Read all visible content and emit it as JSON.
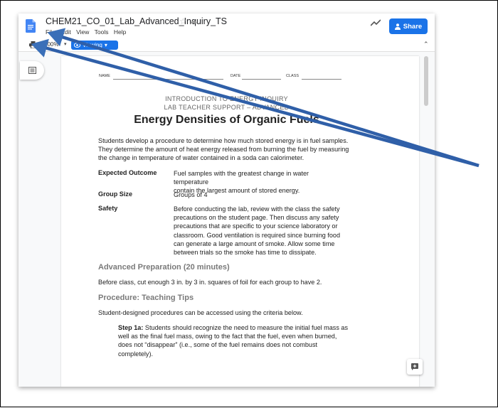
{
  "app": {
    "doc_title": "CHEM21_CO_01_Lab_Advanced_Inquiry_TS",
    "menu": [
      "File",
      "Edit",
      "View",
      "Tools",
      "Help"
    ],
    "share_label": "Share",
    "zoom": "100%",
    "view_label": "Viewing"
  },
  "doc": {
    "name_label": "NAME",
    "date_label": "DATE",
    "class_label": "CLASS",
    "header1": "INTRODUCTION TO ENERGY INQUIRY",
    "header2": "LAB TEACHER SUPPORT – ADVANCED",
    "title": "Energy Densities of Organic Fuels",
    "intro": [
      "Students develop a procedure to determine how much stored energy is in fuel samples.",
      "They determine the amount of heat energy released from burning the fuel by measuring",
      "the change in temperature of water contained in a soda can calorimeter."
    ],
    "outcome_label": "Expected Outcome",
    "outcome_lines": [
      "Fuel samples with the greatest change in water temperature",
      "contain the largest amount of stored energy."
    ],
    "group_label": "Group Size",
    "group_value": "Groups of 4",
    "safety_label": "Safety",
    "safety_lines": [
      "Before conducting the lab, review with the class the safety",
      "precautions on the student page. Then discuss any safety",
      "precautions that are specific to your science laboratory or",
      "classroom. Good ventilation is required since burning food",
      "can generate a large amount of smoke. Allow some time",
      "between trials so the smoke has time to dissipate."
    ],
    "prep_heading": "Advanced Preparation (20 minutes)",
    "prep_text": "Before class, cut enough 3 in. by 3 in. squares of foil for each group to have 2.",
    "proc_heading": "Procedure: Teaching Tips",
    "proc_text": "Student-designed procedures can be accessed using the criteria below.",
    "step_label": "Step 1a:",
    "step_lines": [
      " Students should recognize the need to measure the initial fuel mass as",
      "well as the final fuel mass, owing to the fact that the fuel, even when burned,",
      "does not “disappear” (i.e., some of the fuel remains does not combust",
      "completely)."
    ]
  },
  "colors": {
    "accent": "#1a73e8",
    "annotation_arrow": "#3a6fb8"
  },
  "icons": [
    "docs-icon",
    "star-icon",
    "cloud-icon",
    "trend-icon",
    "share-person-icon",
    "print-icon",
    "eye-icon",
    "chevron-up-icon",
    "outline-icon",
    "add-comment-icon"
  ]
}
